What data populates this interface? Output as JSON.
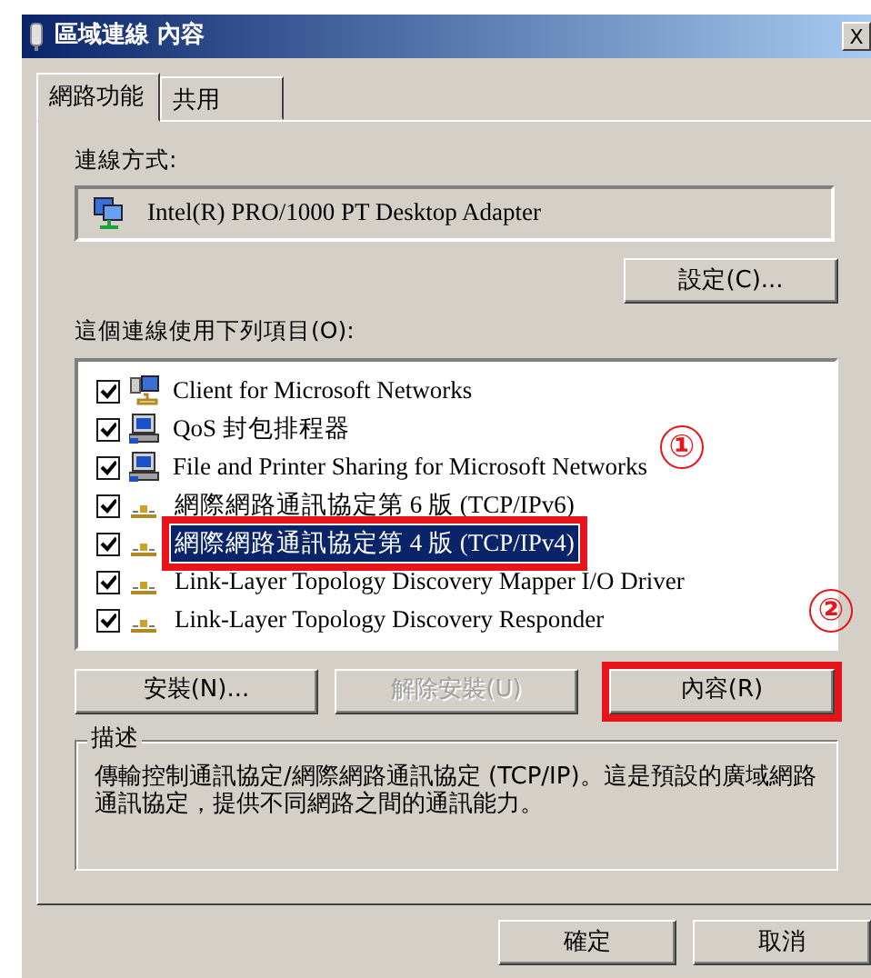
{
  "window": {
    "title": "區域連線 內容",
    "close": "X"
  },
  "tabs": [
    {
      "label": "網路功能",
      "selected": true
    },
    {
      "label": "共用",
      "selected": false
    }
  ],
  "connect_using": {
    "label": "連線方式:",
    "adapter": "Intel(R) PRO/1000 PT Desktop Adapter",
    "configure_button": "設定(C)..."
  },
  "items_label": "這個連線使用下列項目(O):",
  "items": [
    {
      "label": "Client for Microsoft Networks",
      "kind": "client",
      "checked": true,
      "selected": false,
      "highlighted": false
    },
    {
      "label": "QoS 封包排程器",
      "kind": "service",
      "checked": true,
      "selected": false,
      "highlighted": false
    },
    {
      "label": "File and Printer Sharing for Microsoft Networks",
      "kind": "service",
      "checked": true,
      "selected": false,
      "highlighted": false
    },
    {
      "label": "網際網路通訊協定第 6 版 (TCP/IPv6)",
      "kind": "protocol",
      "checked": true,
      "selected": false,
      "highlighted": false
    },
    {
      "label": "網際網路通訊協定第 4 版 (TCP/IPv4)",
      "kind": "protocol",
      "checked": true,
      "selected": true,
      "highlighted": true
    },
    {
      "label": "Link-Layer Topology Discovery Mapper I/O Driver",
      "kind": "protocol",
      "checked": true,
      "selected": false,
      "highlighted": false
    },
    {
      "label": "Link-Layer Topology Discovery Responder",
      "kind": "protocol",
      "checked": true,
      "selected": false,
      "highlighted": false
    }
  ],
  "annotations": [
    {
      "label": "①"
    },
    {
      "label": "②"
    }
  ],
  "item_buttons": [
    {
      "label": "安裝(N)...",
      "disabled": false,
      "highlighted": false
    },
    {
      "label": "解除安裝(U)",
      "disabled": true,
      "highlighted": false
    },
    {
      "label": "內容(R)",
      "disabled": false,
      "highlighted": true
    }
  ],
  "description": {
    "title": "描述",
    "text": "傳輸控制通訊協定/網際網路通訊協定 (TCP/IP)。這是預設的廣域網路通訊協定，提供不同網路之間的通訊能力。"
  },
  "dialog_buttons": [
    "確定",
    "取消"
  ]
}
